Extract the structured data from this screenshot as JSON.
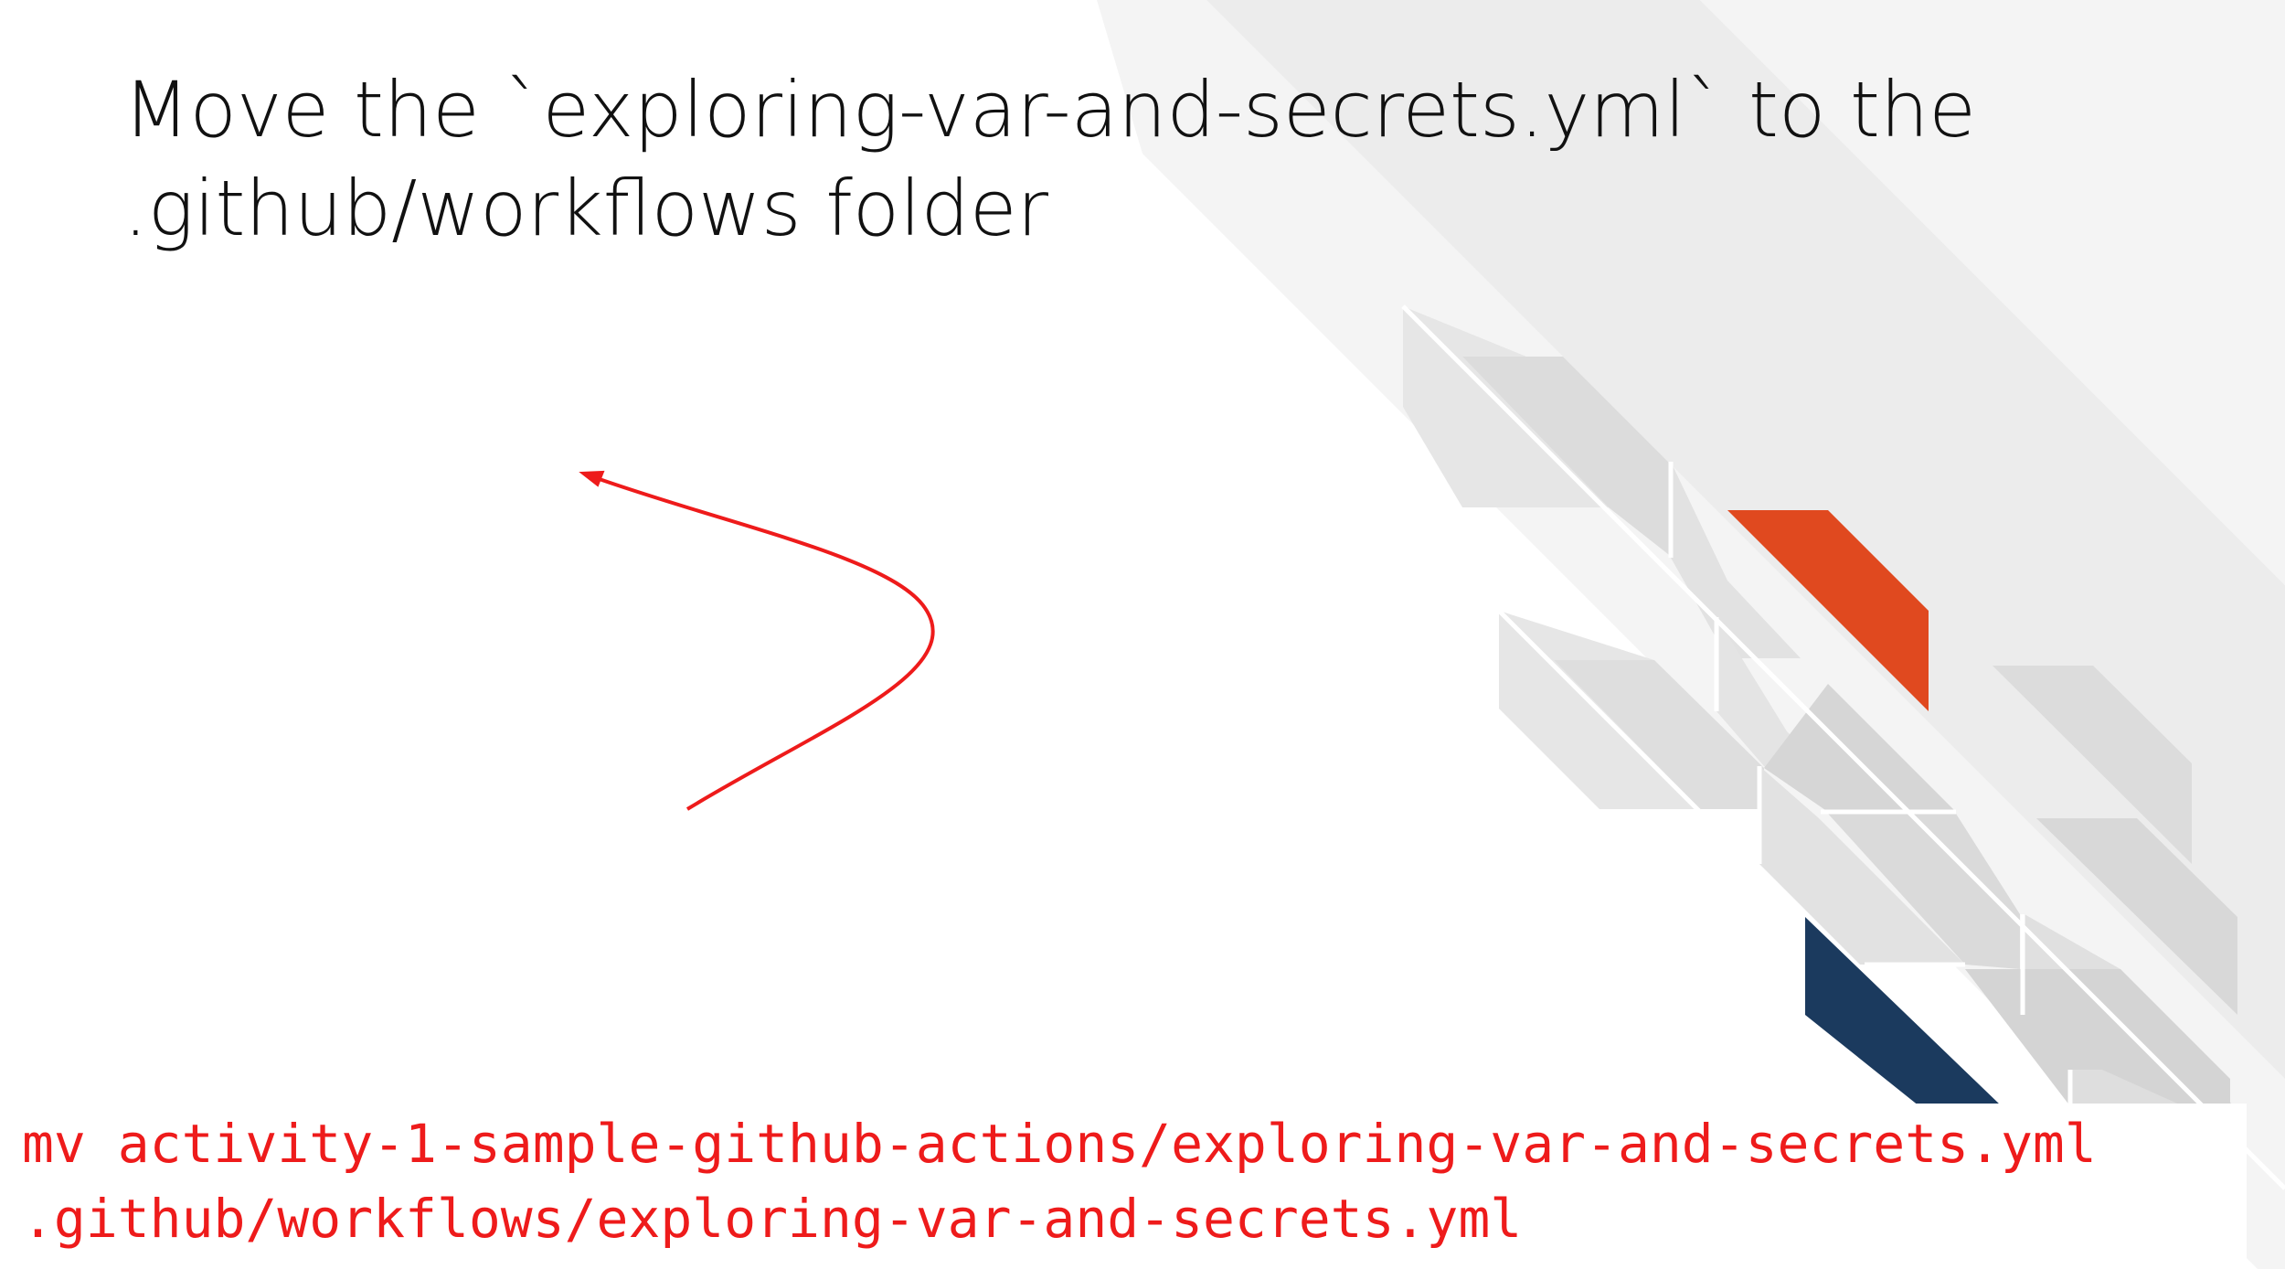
{
  "slide": {
    "title_lines": [
      "Move the `exploring-var-and-secrets.yml` to the",
      ".github/workflows folder"
    ],
    "command_lines": [
      "mv activity-1-sample-github-actions/exploring-var-and-secrets.yml",
      ".github/workflows/exploring-var-and-secrets.yml"
    ]
  },
  "colors": {
    "accent_orange": "#e0491f",
    "accent_navy": "#1b3a5e",
    "command_red": "#ee1b1b",
    "arrow_red": "#ee1b1b",
    "stripe_grays": [
      "#f3f3f3",
      "#e4e4e4",
      "#d9d9d9"
    ]
  },
  "icons": {
    "arrow": "curved-arrow-icon"
  }
}
